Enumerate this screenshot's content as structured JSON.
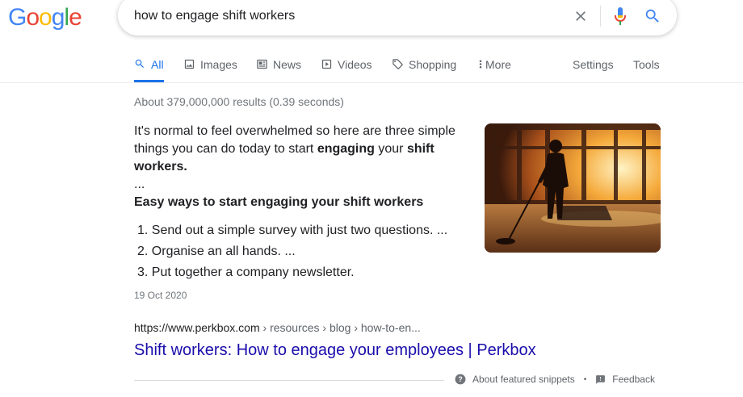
{
  "logo": {
    "letters": [
      "G",
      "o",
      "o",
      "g",
      "l",
      "e"
    ],
    "colors": [
      "#4285F4",
      "#EA4335",
      "#FBBC05",
      "#4285F4",
      "#34A853",
      "#EA4335"
    ]
  },
  "search": {
    "query": "how to engage shift workers",
    "icons": [
      "close-icon",
      "microphone-icon",
      "search-icon"
    ]
  },
  "tabs": [
    {
      "label": "All",
      "icon": "search-icon",
      "active": true
    },
    {
      "label": "Images",
      "icon": "image-icon"
    },
    {
      "label": "News",
      "icon": "news-icon"
    },
    {
      "label": "Videos",
      "icon": "video-icon"
    },
    {
      "label": "Shopping",
      "icon": "tag-icon"
    },
    {
      "label": "More",
      "icon": "more-vert-icon"
    }
  ],
  "tools": {
    "settings": "Settings",
    "tools": "Tools"
  },
  "stats": "About 379,000,000 results (0.39 seconds)",
  "snippet": {
    "text_1": "It's normal to feel overwhelmed so here are three simple things you can do today to start ",
    "bold_1": "engaging",
    "text_2": " your ",
    "bold_2": "shift workers",
    "text_3": ".",
    "ellipsis": "...",
    "list_heading": "Easy ways to start engaging your shift workers",
    "list_items": [
      "1. Send out a simple survey with just two questions. ...",
      "2. Organise an all hands. ...",
      "3. Put together a company newsletter."
    ],
    "date": "19 Oct 2020"
  },
  "result": {
    "cite_domain": "https://www.perkbox.com",
    "cite_path": " › resources › blog › how-to-en...",
    "title": "Shift workers: How to engage your employees | Perkbox"
  },
  "footer": {
    "about": "About featured snippets",
    "separator": "•",
    "feedback": "Feedback"
  },
  "accent_color": "#1a73e8",
  "link_color": "#1a0dab"
}
